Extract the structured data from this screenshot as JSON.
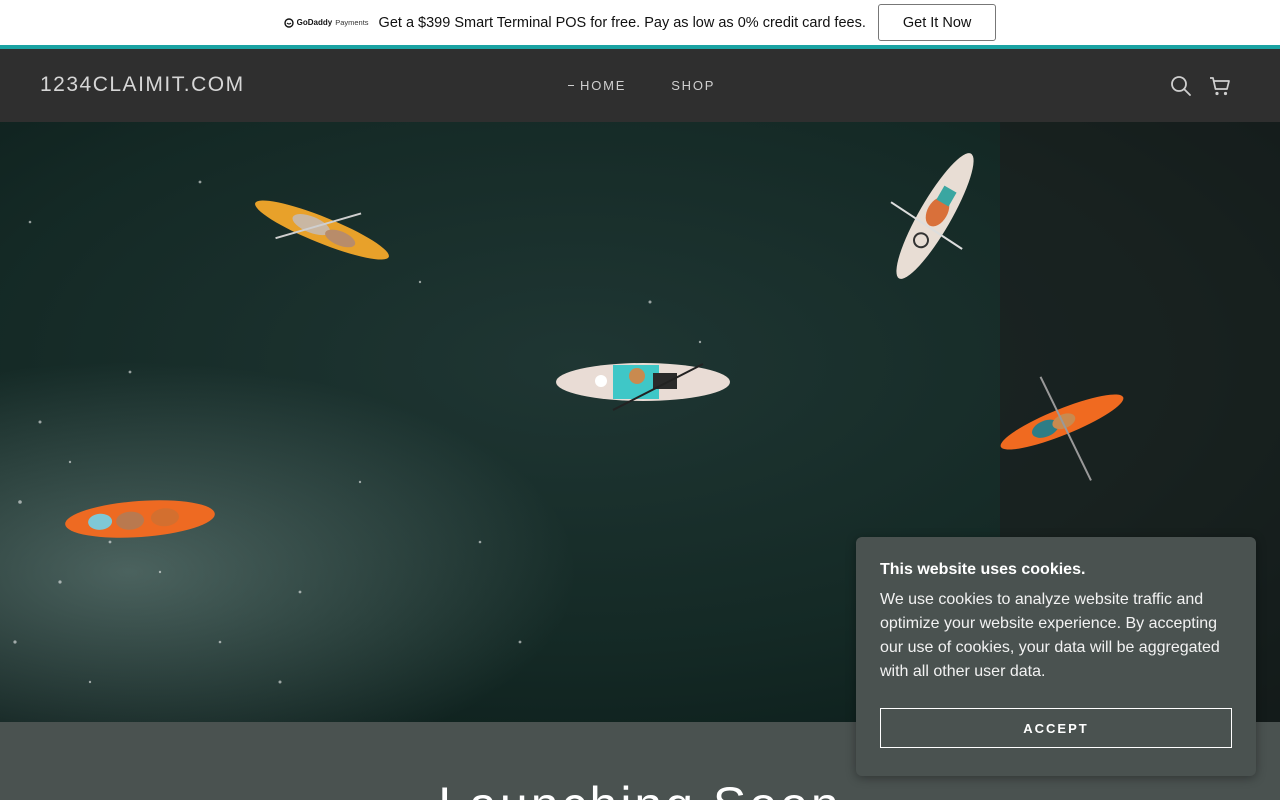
{
  "promo": {
    "logo_brand": "GoDaddy",
    "logo_sub": "Payments",
    "text": "Get a $399 Smart Terminal POS for free. Pay as low as 0% credit card fees.",
    "button": "Get It Now",
    "accent": "#1aa3a3"
  },
  "header": {
    "site_title": "1234CLAIMIT.COM",
    "nav": [
      {
        "label": "HOME",
        "active": true
      },
      {
        "label": "SHOP",
        "active": false
      }
    ],
    "icons": [
      "search-icon",
      "cart-icon"
    ]
  },
  "hero": {
    "image": "aerial view of kayaks and a paddleboard on dark water"
  },
  "main": {
    "heading": "Launching Soon"
  },
  "cookie": {
    "title": "This website uses cookies.",
    "body": "We use cookies to analyze website traffic and optimize your website experience. By accepting our use of cookies, your data will be aggregated with all other user data.",
    "button": "ACCEPT"
  }
}
